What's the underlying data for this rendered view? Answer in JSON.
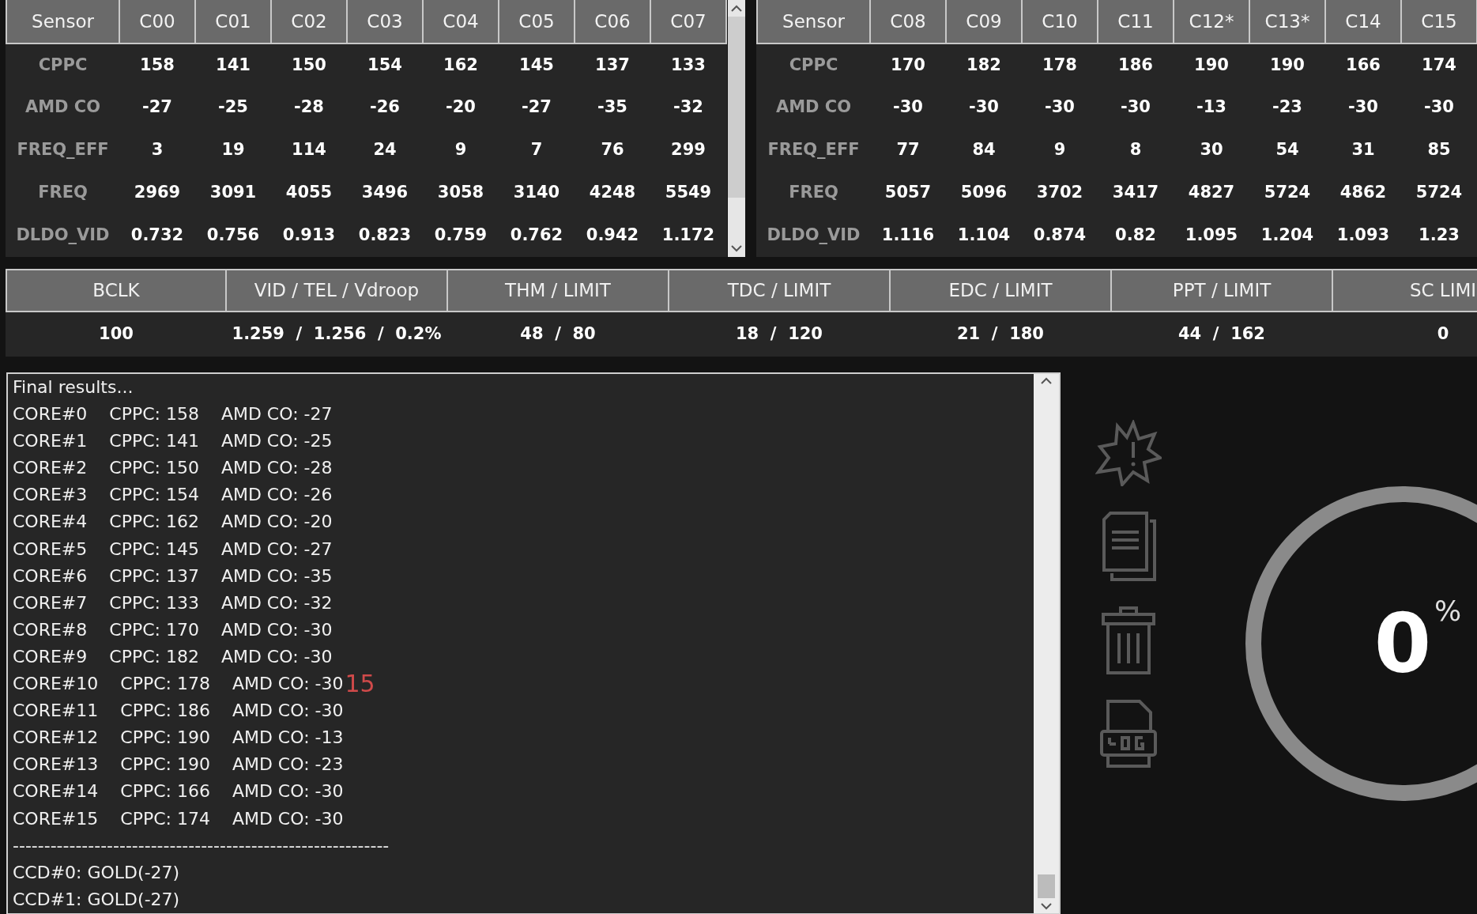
{
  "sensor_tables": [
    {
      "columns": [
        "Sensor",
        "C00",
        "C01",
        "C02",
        "C03",
        "C04",
        "C05",
        "C06",
        "C07"
      ],
      "rows": [
        {
          "label": "CPPC",
          "values": [
            "158",
            "141",
            "150",
            "154",
            "162",
            "145",
            "137",
            "133"
          ]
        },
        {
          "label": "AMD CO",
          "values": [
            "-27",
            "-25",
            "-28",
            "-26",
            "-20",
            "-27",
            "-35",
            "-32"
          ]
        },
        {
          "label": "FREQ_EFF",
          "values": [
            "3",
            "19",
            "114",
            "24",
            "9",
            "7",
            "76",
            "299"
          ]
        },
        {
          "label": "FREQ",
          "values": [
            "2969",
            "3091",
            "4055",
            "3496",
            "3058",
            "3140",
            "4248",
            "5549"
          ]
        },
        {
          "label": "DLDO_VID",
          "values": [
            "0.732",
            "0.756",
            "0.913",
            "0.823",
            "0.759",
            "0.762",
            "0.942",
            "1.172"
          ]
        }
      ]
    },
    {
      "columns": [
        "Sensor",
        "C08",
        "C09",
        "C10",
        "C11",
        "C12*",
        "C13*",
        "C14",
        "C15"
      ],
      "rows": [
        {
          "label": "CPPC",
          "values": [
            "170",
            "182",
            "178",
            "186",
            "190",
            "190",
            "166",
            "174"
          ]
        },
        {
          "label": "AMD CO",
          "values": [
            "-30",
            "-30",
            "-30",
            "-30",
            "-13",
            "-23",
            "-30",
            "-30"
          ]
        },
        {
          "label": "FREQ_EFF",
          "values": [
            "77",
            "84",
            "9",
            "8",
            "30",
            "54",
            "31",
            "85"
          ]
        },
        {
          "label": "FREQ",
          "values": [
            "5057",
            "5096",
            "3702",
            "3417",
            "4827",
            "5724",
            "4862",
            "5724"
          ]
        },
        {
          "label": "DLDO_VID",
          "values": [
            "1.116",
            "1.104",
            "0.874",
            "0.82",
            "1.095",
            "1.204",
            "1.093",
            "1.23"
          ]
        }
      ]
    }
  ],
  "limits": {
    "columns": [
      "BCLK",
      "VID / TEL / Vdroop",
      "THM / LIMIT",
      "TDC / LIMIT",
      "EDC / LIMIT",
      "PPT / LIMIT",
      "SC LIMI"
    ],
    "values": [
      "100",
      "1.259  /  1.256  /  0.2%",
      "48  /  80",
      "18  /  120",
      "21  /  180",
      "44  /  162",
      "0"
    ]
  },
  "log": {
    "lines": [
      {
        "text": "Final results..."
      },
      {
        "text": "CORE#0    CPPC: 158    AMD CO: -27"
      },
      {
        "text": "CORE#1    CPPC: 141    AMD CO: -25"
      },
      {
        "text": "CORE#2    CPPC: 150    AMD CO: -28"
      },
      {
        "text": "CORE#3    CPPC: 154    AMD CO: -26"
      },
      {
        "text": "CORE#4    CPPC: 162    AMD CO: -20"
      },
      {
        "text": "CORE#5    CPPC: 145    AMD CO: -27"
      },
      {
        "text": "CORE#6    CPPC: 137    AMD CO: -35"
      },
      {
        "text": "CORE#7    CPPC: 133    AMD CO: -32"
      },
      {
        "text": "CORE#8    CPPC: 170    AMD CO: -30"
      },
      {
        "text": "CORE#9    CPPC: 182    AMD CO: -30"
      },
      {
        "text": "CORE#10    CPPC: 178    AMD CO: -30",
        "annotation": "15"
      },
      {
        "text": "CORE#11    CPPC: 186    AMD CO: -30"
      },
      {
        "text": "CORE#12    CPPC: 190    AMD CO: -13"
      },
      {
        "text": "CORE#13    CPPC: 190    AMD CO: -23"
      },
      {
        "text": "CORE#14    CPPC: 166    AMD CO: -30"
      },
      {
        "text": "CORE#15    CPPC: 174    AMD CO: -30"
      },
      {
        "text": "------------------------------------------------------------"
      },
      {
        "text": "CCD#0: GOLD(-27)"
      },
      {
        "text": "CCD#1: GOLD(-27)"
      }
    ]
  },
  "progress": {
    "value": "0",
    "unit": "%"
  }
}
